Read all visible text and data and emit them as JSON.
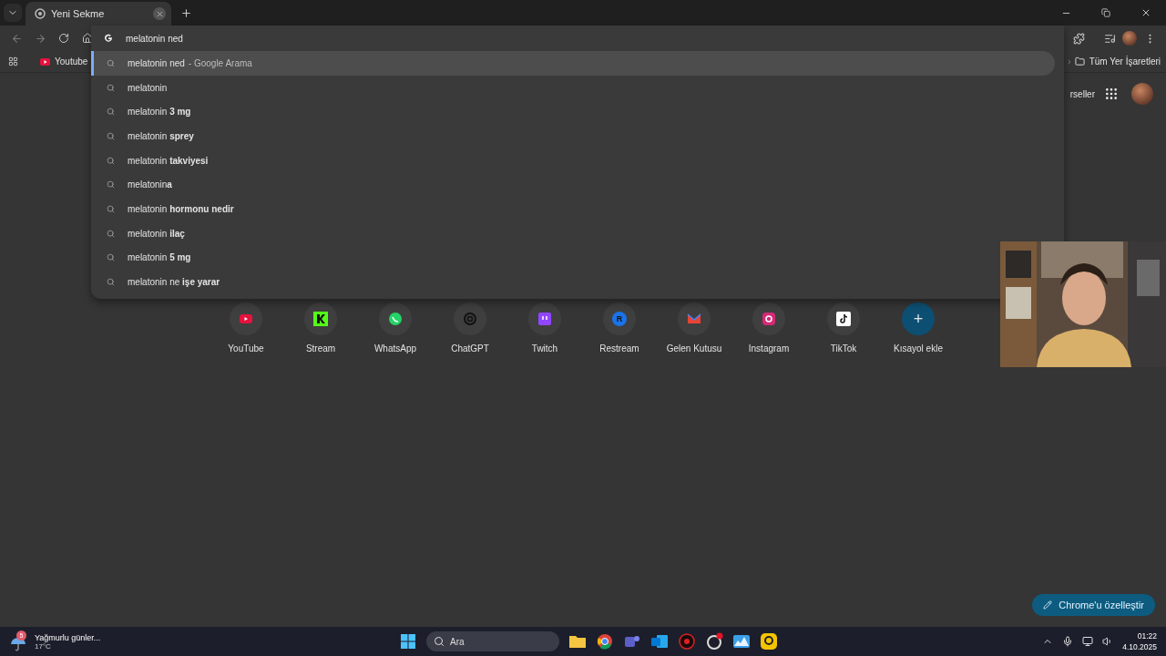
{
  "tabs": [
    {
      "title": "Yeni Sekme",
      "selected": true
    }
  ],
  "omnibox": {
    "value": "melatonin ned"
  },
  "bookmarks": [
    {
      "label": "Youtube"
    }
  ],
  "bookmarks_all": "Tüm Yer İşaretleri",
  "suggestions": [
    {
      "text": "melatonin ned",
      "suffix": "- Google Arama",
      "selected": true
    },
    {
      "text": "melatonin",
      "selected": false
    },
    {
      "text": "melatonin **3 mg**",
      "selected": false
    },
    {
      "text": "melatonin **sprey**",
      "selected": false
    },
    {
      "text": "melatonin **takviyesi**",
      "selected": false
    },
    {
      "text": "melatonin**a**",
      "selected": false
    },
    {
      "text": "melatonin **hormonu nedir**",
      "selected": false
    },
    {
      "text": "melatonin **ilaç**",
      "selected": false
    },
    {
      "text": "melatonin **5 mg**",
      "selected": false
    },
    {
      "text": "melatonin ne **işe yarar**",
      "selected": false
    }
  ],
  "header_link": "rseller",
  "shortcuts": [
    {
      "label": "YouTube",
      "kind": "site"
    },
    {
      "label": "Stream",
      "kind": "site"
    },
    {
      "label": "WhatsApp",
      "kind": "site"
    },
    {
      "label": "ChatGPT",
      "kind": "site"
    },
    {
      "label": "Twitch",
      "kind": "site"
    },
    {
      "label": "Restream",
      "kind": "site",
      "letter": "R"
    },
    {
      "label": "Gelen Kutusu",
      "kind": "site"
    },
    {
      "label": "Instagram",
      "kind": "site"
    },
    {
      "label": "TikTok",
      "kind": "site"
    },
    {
      "label": "Kısayol ekle",
      "kind": "add",
      "symbol": "+"
    }
  ],
  "customize_button": "Chrome'u özelleştir",
  "taskbar": {
    "weather": {
      "title": "Yağmurlu günler...",
      "temp": "17°C",
      "badge": "5"
    },
    "search_placeholder": "Ara",
    "time": "01:22",
    "date": "4.10.2025"
  }
}
